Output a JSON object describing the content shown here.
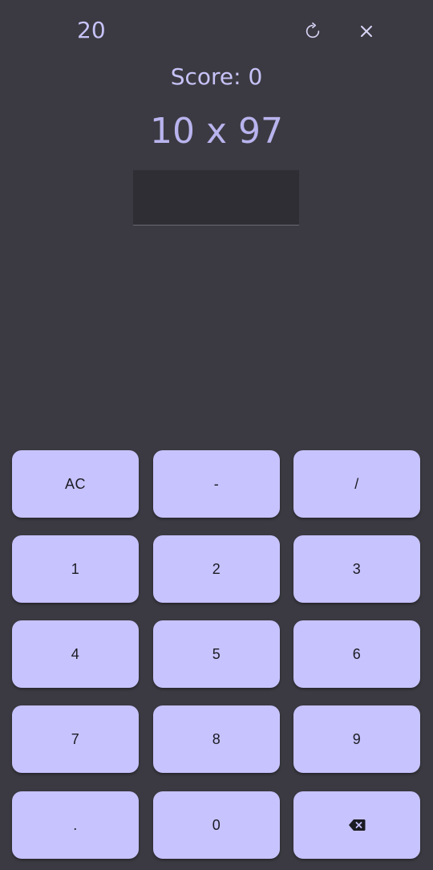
{
  "header": {
    "timer": "20",
    "refresh_icon": "refresh-icon",
    "close_icon": "close-icon"
  },
  "score_text": "Score: 0",
  "question": "10 x 97",
  "answer": {
    "value": ""
  },
  "keypad": {
    "keys": [
      "AC",
      "-",
      "/",
      "1",
      "2",
      "3",
      "4",
      "5",
      "6",
      "7",
      "8",
      "9",
      ".",
      "0"
    ],
    "backspace_icon": "backspace-icon"
  },
  "colors": {
    "background": "#3b3a42",
    "accent": "#c7c3ff",
    "text_accent": "#c7c3f8",
    "input_bg": "#2f2e34"
  }
}
